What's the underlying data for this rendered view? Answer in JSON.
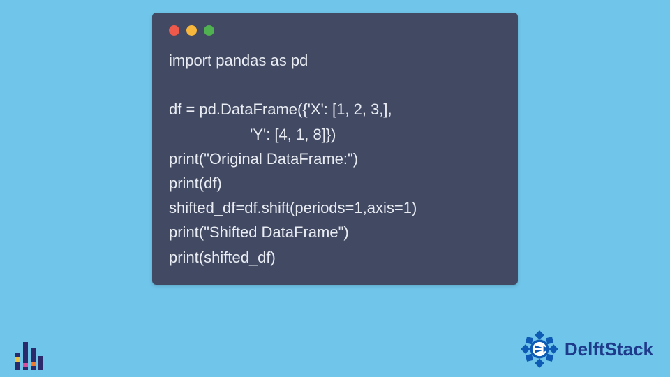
{
  "code_window": {
    "lines": [
      "import pandas as pd",
      "",
      "df = pd.DataFrame({'X': [1, 2, 3,],",
      "                   'Y': [4, 1, 8]})",
      "print(\"Original DataFrame:\")",
      "print(df)",
      "shifted_df=df.shift(periods=1,axis=1)",
      "print(\"Shifted DataFrame\")",
      "print(shifted_df)"
    ],
    "dot_colors": {
      "red": "#ed594a",
      "yellow": "#f6b73c",
      "green": "#4fb14f"
    }
  },
  "brand": {
    "name": "DelftStack",
    "badge_color": "#0d5bb5"
  },
  "background_color": "#70c6ea"
}
